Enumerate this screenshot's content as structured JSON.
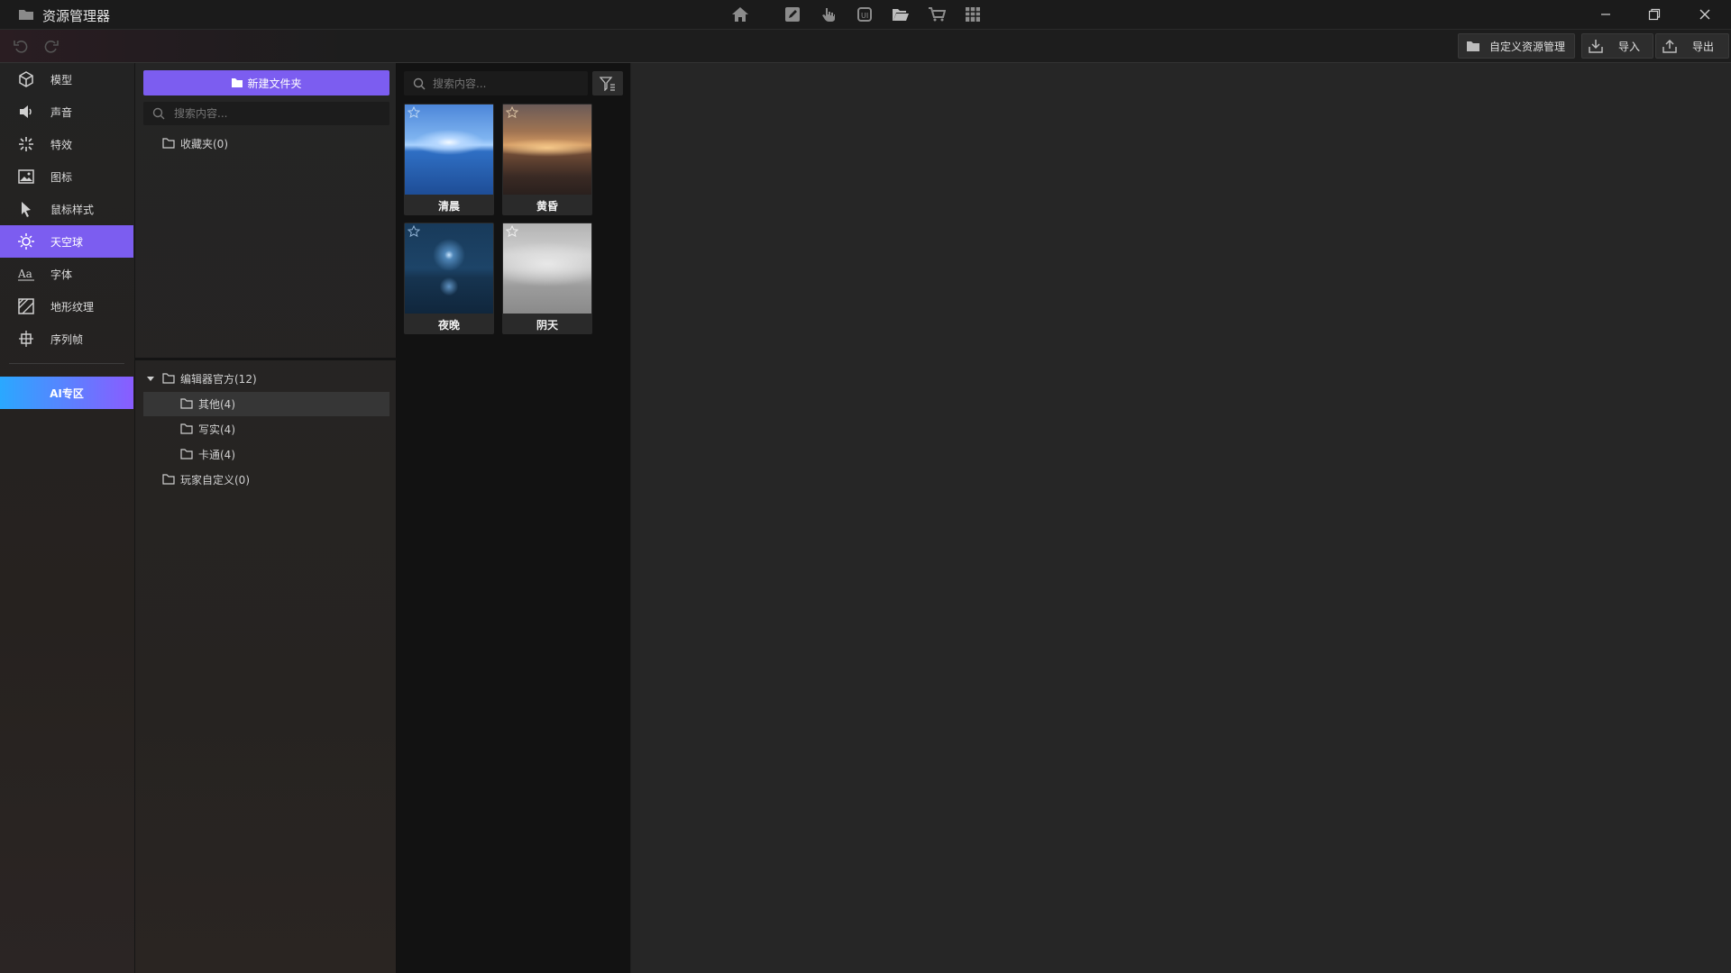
{
  "window": {
    "title": "资源管理器"
  },
  "toolbar": {
    "custom_manage_label": "自定义资源管理",
    "import_label": "导入",
    "export_label": "导出"
  },
  "sidebar": {
    "items": [
      {
        "label": "模型",
        "icon": "cube-icon"
      },
      {
        "label": "声音",
        "icon": "speaker-icon"
      },
      {
        "label": "特效",
        "icon": "sparkle-icon"
      },
      {
        "label": "图标",
        "icon": "image-icon"
      },
      {
        "label": "鼠标样式",
        "icon": "cursor-icon"
      },
      {
        "label": "天空球",
        "icon": "sun-icon"
      },
      {
        "label": "字体",
        "icon": "font-icon"
      },
      {
        "label": "地形纹理",
        "icon": "texture-icon"
      },
      {
        "label": "序列帧",
        "icon": "sequence-icon"
      }
    ],
    "active_index": 5,
    "ai_button": "AI专区"
  },
  "folders": {
    "new_folder_label": "新建文件夹",
    "search_placeholder": "搜索内容...",
    "favorites": "收藏夹(0)",
    "tree": {
      "root": "编辑器官方(12)",
      "children": [
        "其他(4)",
        "写实(4)",
        "卡通(4)"
      ],
      "custom": "玩家自定义(0)"
    }
  },
  "assets": {
    "search_placeholder": "搜索内容...",
    "items": [
      {
        "label": "清晨"
      },
      {
        "label": "黄昏"
      },
      {
        "label": "夜晚"
      },
      {
        "label": "阴天"
      }
    ]
  },
  "colors": {
    "accent": "#7c5df0",
    "ai_gradient_start": "#2aa8ff",
    "ai_gradient_end": "#8a5cff"
  }
}
